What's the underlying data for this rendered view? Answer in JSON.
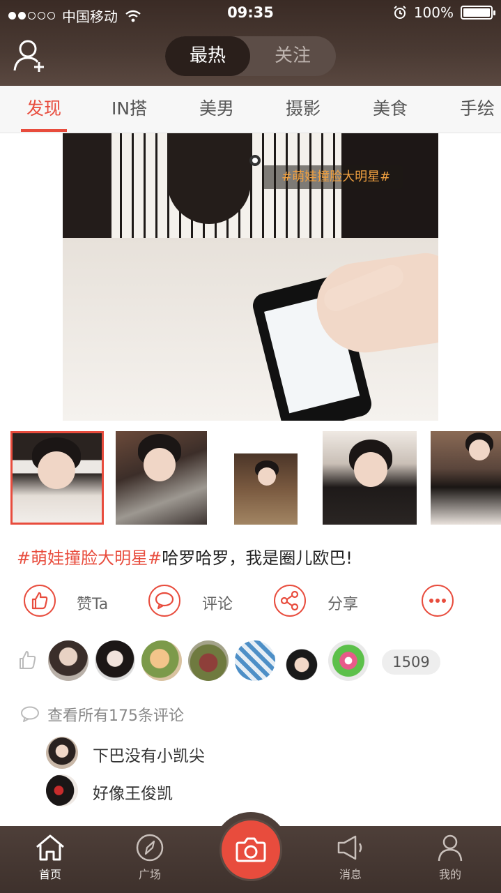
{
  "status_bar": {
    "carrier": "中国移动",
    "time": "09:35",
    "battery_text": "100%"
  },
  "top_nav": {
    "segments": [
      {
        "label": "最热",
        "active": true
      },
      {
        "label": "关注",
        "active": false
      }
    ]
  },
  "category_tabs": [
    {
      "label": "发现",
      "active": true
    },
    {
      "label": "IN搭",
      "active": false
    },
    {
      "label": "美男",
      "active": false
    },
    {
      "label": "摄影",
      "active": false
    },
    {
      "label": "美食",
      "active": false
    },
    {
      "label": "手绘",
      "active": false
    }
  ],
  "post": {
    "photo_tag": "#萌娃撞脸大明星#",
    "caption_hashtag": "#萌娃撞脸大明星#",
    "caption_text": "哈罗哈罗，我是圈儿欧巴!",
    "actions": {
      "like_label": "赞Ta",
      "comment_label": "评论",
      "share_label": "分享"
    },
    "like_count": "1509",
    "view_comments_label": "查看所有175条评论",
    "comments": [
      {
        "text": "下巴没有小凯尖"
      },
      {
        "text": "好像王俊凯"
      }
    ]
  },
  "tab_bar": {
    "items": [
      {
        "label": "首页",
        "active": true
      },
      {
        "label": "广场",
        "active": false
      },
      {
        "label": "消息",
        "active": false
      },
      {
        "label": "我的",
        "active": false
      }
    ]
  },
  "colors": {
    "accent": "#e84c3d",
    "header_bg": "#3e312c"
  },
  "icons": [
    "add-user-icon",
    "wifi-icon",
    "alarm-icon",
    "like-icon",
    "comment-icon",
    "share-icon",
    "more-icon",
    "home-icon",
    "compass-icon",
    "camera-icon",
    "megaphone-icon",
    "person-icon"
  ]
}
